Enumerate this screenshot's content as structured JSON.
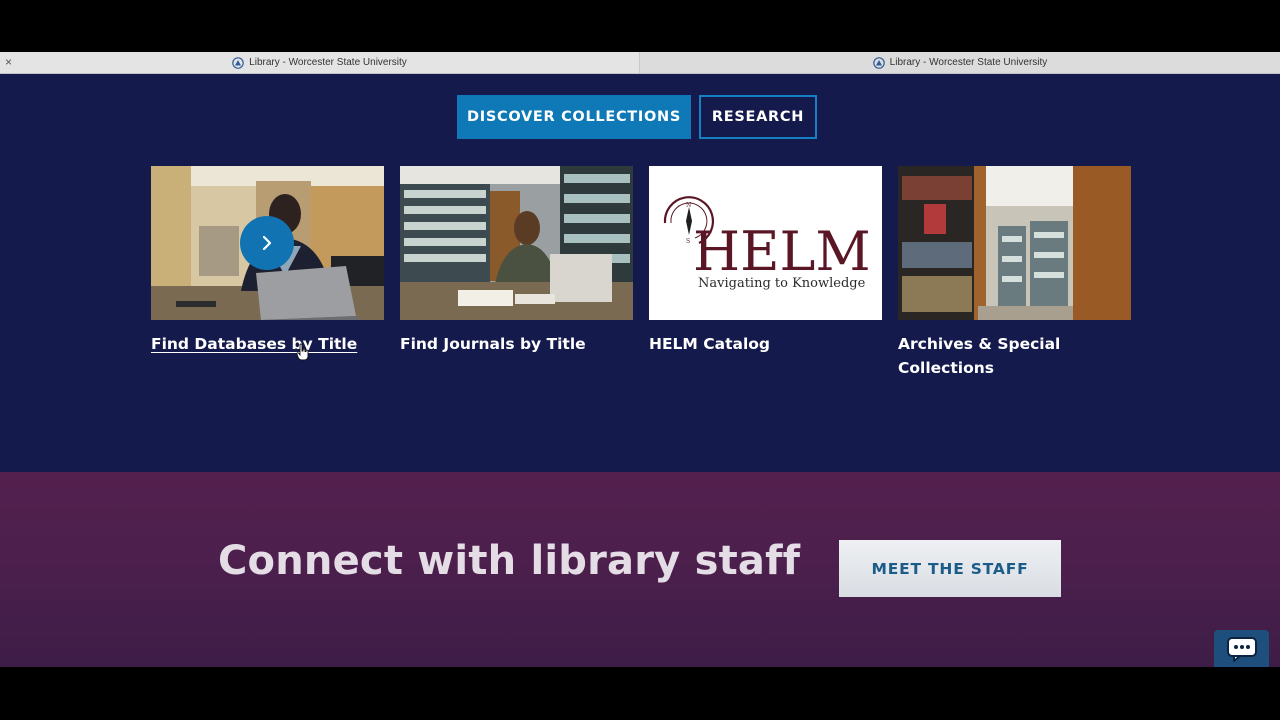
{
  "browser": {
    "tabs": [
      {
        "title": "Library - Worcester State University",
        "close_glyph": "×"
      },
      {
        "title": "Library - Worcester State University"
      }
    ]
  },
  "hero": {
    "toggles": [
      {
        "label": "DISCOVER COLLECTIONS",
        "active": true
      },
      {
        "label": "RESEARCH",
        "active": false
      }
    ]
  },
  "cards": [
    {
      "label": "Find Databases by Title",
      "image": "student-with-laptop-photo",
      "hovered": true
    },
    {
      "label": "Find Journals by Title",
      "image": "student-reading-in-stacks-photo"
    },
    {
      "label": "HELM Catalog",
      "image": "helm-logo",
      "logo_text": "HELM",
      "logo_tagline": "Navigating to Knowledge"
    },
    {
      "label": "Archives & Special Collections",
      "image": "library-stacks-photo"
    }
  ],
  "connect": {
    "title": "Connect with library staff",
    "button_label": "MEET THE STAFF"
  },
  "colors": {
    "navy": "#141a4c",
    "accent_blue": "#0f78b6",
    "plum": "#4a1f4c",
    "helm_maroon": "#5a1625"
  },
  "chat_widget": {
    "icon": "chat-bubble-icon"
  }
}
